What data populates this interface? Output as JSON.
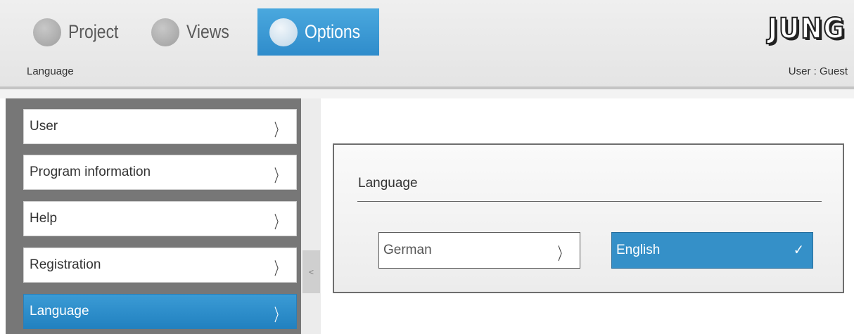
{
  "tabs": [
    {
      "label": "Project"
    },
    {
      "label": "Views"
    },
    {
      "label": "Options"
    }
  ],
  "brand": {
    "logo_text": "JUNG"
  },
  "breadcrumb": "Language",
  "user_label": "User : Guest",
  "sidebar": {
    "items": [
      {
        "label": "User"
      },
      {
        "label": "Program information"
      },
      {
        "label": "Help"
      },
      {
        "label": "Registration"
      },
      {
        "label": "Language"
      }
    ],
    "chevron": "〉",
    "collapse_glyph": "<"
  },
  "panel": {
    "title": "Language",
    "options": [
      {
        "label": "German",
        "icon": "〉"
      },
      {
        "label": "English",
        "icon": "✓"
      }
    ]
  },
  "colors": {
    "accent": "#2f8ccb",
    "sidebar_bg": "#777777"
  }
}
